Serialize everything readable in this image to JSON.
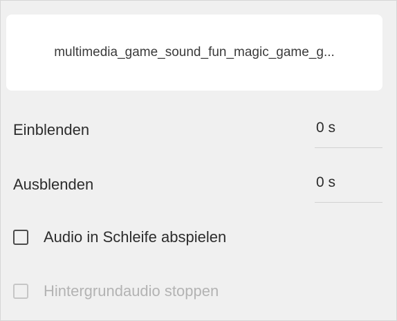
{
  "file": {
    "name": "multimedia_game_sound_fun_magic_game_g..."
  },
  "fade_in": {
    "label": "Einblenden",
    "value": "0 s"
  },
  "fade_out": {
    "label": "Ausblenden",
    "value": "0 s"
  },
  "loop_audio": {
    "label": "Audio in Schleife abspielen",
    "checked": false,
    "enabled": true
  },
  "stop_background_audio": {
    "label": "Hintergrundaudio stoppen",
    "checked": false,
    "enabled": false
  },
  "colors": {
    "panel_background": "#f0f0f0",
    "card_background": "#ffffff",
    "text": "#2c2c2c",
    "disabled_text": "#b3b3b3"
  }
}
